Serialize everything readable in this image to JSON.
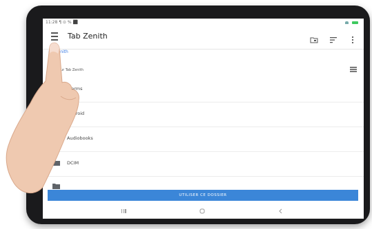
{
  "status_bar": {
    "time": "11:28 ¶ ⊙ % ⬛"
  },
  "app_bar": {
    "title": "Tab Zenith"
  },
  "breadcrumb": {
    "label": "ab Zenith"
  },
  "section": {
    "header": "ihiers sur Tab Zenith"
  },
  "folders": [
    {
      "name": "Alarms",
      "icon": "folder-icon"
    },
    {
      "name": "Android",
      "icon": "folder-icon"
    },
    {
      "name": "Audiobooks",
      "icon": "folder-icon"
    },
    {
      "name": "DCIM",
      "icon": "folder-icon"
    }
  ],
  "use_folder_button": {
    "label": "UTILISER CE DOSSIER",
    "color": "#3b86d8"
  },
  "colors": {
    "accent": "#3b86d8",
    "link": "#3a7be3",
    "battery": "#3ec95f"
  }
}
